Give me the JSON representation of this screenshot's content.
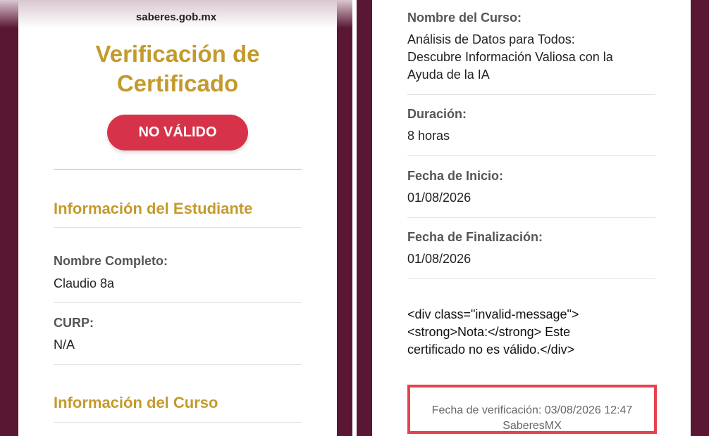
{
  "left": {
    "site": "saberes.gob.mx",
    "title_line1": "Verificación de",
    "title_line2": "Certificado",
    "status_badge": "NO VÁLIDO",
    "student_section": "Información del Estudiante",
    "name_label": "Nombre Completo:",
    "name_value": "Claudio 8a",
    "curp_label": "CURP:",
    "curp_value": "N/A",
    "course_section": "Información del Curso"
  },
  "right": {
    "course_name_label": "Nombre del Curso:",
    "course_name_line1": "Análisis de Datos para Todos:",
    "course_name_line2": "Descubre Información Valiosa con la",
    "course_name_line3": "Ayuda de la IA",
    "duration_label": "Duración:",
    "duration_value": "8 horas",
    "start_label": "Fecha de Inicio:",
    "start_value": "01/08/2026",
    "end_label": "Fecha de Finalización:",
    "end_value": "01/08/2026",
    "note_line1": "<div class=\"invalid-message\">",
    "note_line2": "<strong>Nota:</strong> Este",
    "note_line3": "certificado no es válido.</div>",
    "verification_line": "Fecha de verificación: 03/08/2026 12:47",
    "footer_brand": "SaberesMX"
  },
  "colors": {
    "brand_gold": "#c39a2c",
    "invalid_red": "#d6334a",
    "frame_maroon": "#5a1733",
    "highlight_red": "#e7414f"
  }
}
